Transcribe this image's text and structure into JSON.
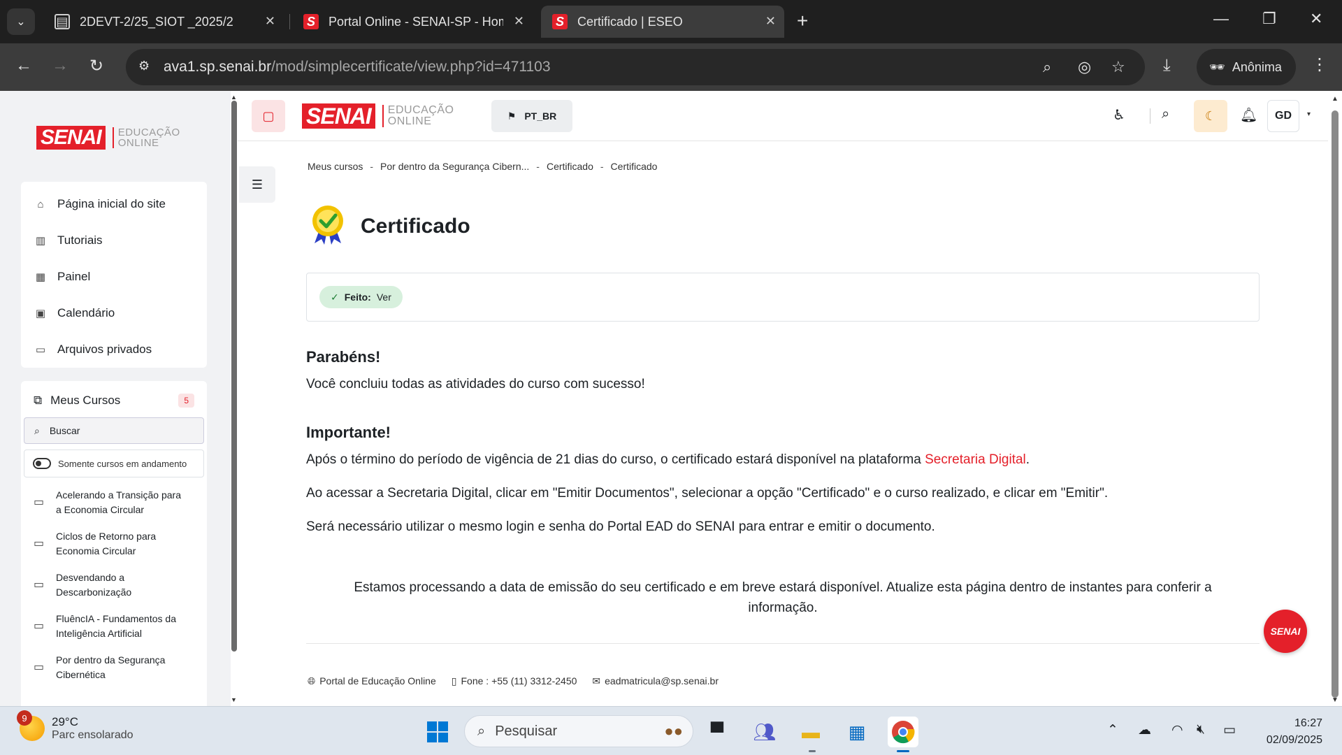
{
  "browser": {
    "tabs": [
      {
        "label": "2DEVT-2/25_SIOT _2025/2",
        "favicon": "doc-icon",
        "active": false
      },
      {
        "label": "Portal Online - SENAI-SP - Hom",
        "favicon": "senai-s-icon",
        "active": false
      },
      {
        "label": "Certificado | ESEO",
        "favicon": "senai-s-icon",
        "active": true
      }
    ],
    "favicon_letter": "S",
    "url_host": "ava1.sp.senai.br",
    "url_path": "/mod/simplecertificate/view.php?id=471103",
    "profile_label": "Anônima"
  },
  "sidebar": {
    "logo_text": "SENAI",
    "logo_sub1": "EDUCAÇÃO",
    "logo_sub2": "ONLINE",
    "nav": [
      {
        "label": "Página inicial do site",
        "icon": "home-icon"
      },
      {
        "label": "Tutoriais",
        "icon": "book-icon"
      },
      {
        "label": "Painel",
        "icon": "dashboard-icon"
      },
      {
        "label": "Calendário",
        "icon": "calendar-icon"
      },
      {
        "label": "Arquivos privados",
        "icon": "inbox-icon"
      }
    ],
    "courses_title": "Meus Cursos",
    "courses_count": "5",
    "search_label": "Buscar",
    "toggle_label": "Somente cursos em andamento",
    "courses": [
      {
        "line1": "Acelerando a Transição para",
        "line2": "a Economia Circular"
      },
      {
        "line1": "Ciclos de Retorno para",
        "line2": "Economia Circular"
      },
      {
        "line1": "Desvendando a",
        "line2": "Descarbonização"
      },
      {
        "line1": "FluêncIA - Fundamentos da",
        "line2": "Inteligência Artificial"
      },
      {
        "line1": "Por dentro da Segurança",
        "line2": "Cibernética"
      }
    ]
  },
  "topbar": {
    "logo_text": "SENAI",
    "logo_sub1": "EDUCAÇÃO",
    "logo_sub2": "ONLINE",
    "lang": "PT_BR",
    "user_initials": "GD"
  },
  "breadcrumb": [
    "Meus cursos",
    "Por dentro da Segurança Cibern...",
    "Certificado",
    "Certificado"
  ],
  "breadcrumb_sep": "-",
  "page": {
    "title": "Certificado",
    "completion_label": "Feito:",
    "completion_value": "Ver",
    "congrats_title": "Parabéns!",
    "congrats_text": "Você concluiu todas as atividades do curso com sucesso!",
    "important_title": "Importante!",
    "p1_before": "Após o término do período de vigência de 21 dias do curso, o certificado estará disponível na plataforma ",
    "p1_link": "Secretaria Digital",
    "p1_after": ".",
    "p2": "Ao acessar a Secretaria Digital, clicar em \"Emitir Documentos\", selecionar a opção \"Certificado\" e o curso realizado, e clicar em \"Emitir\".",
    "p3": "Será necessário utilizar o mesmo login e senha do Portal EAD do SENAI para entrar e emitir o documento.",
    "notice_line1": "Estamos processando a data de emissão do seu certificado e em breve estará disponível. Atualize esta página dentro de instantes para conferir a",
    "notice_line2": "informação."
  },
  "footer": {
    "portal": "Portal de Educação Online",
    "phone": "Fone : +55 (11) 3312-2450",
    "email": "eadmatricula@sp.senai.br",
    "fab_label": "SENAI"
  },
  "taskbar": {
    "weather_badge": "9",
    "temperature": "29°C",
    "condition": "Parc ensolarado",
    "search_placeholder": "Pesquisar",
    "time": "16:27",
    "date": "02/09/2025"
  },
  "colors": {
    "brand_red": "#e4202a",
    "done_green": "#d7f0dd"
  }
}
